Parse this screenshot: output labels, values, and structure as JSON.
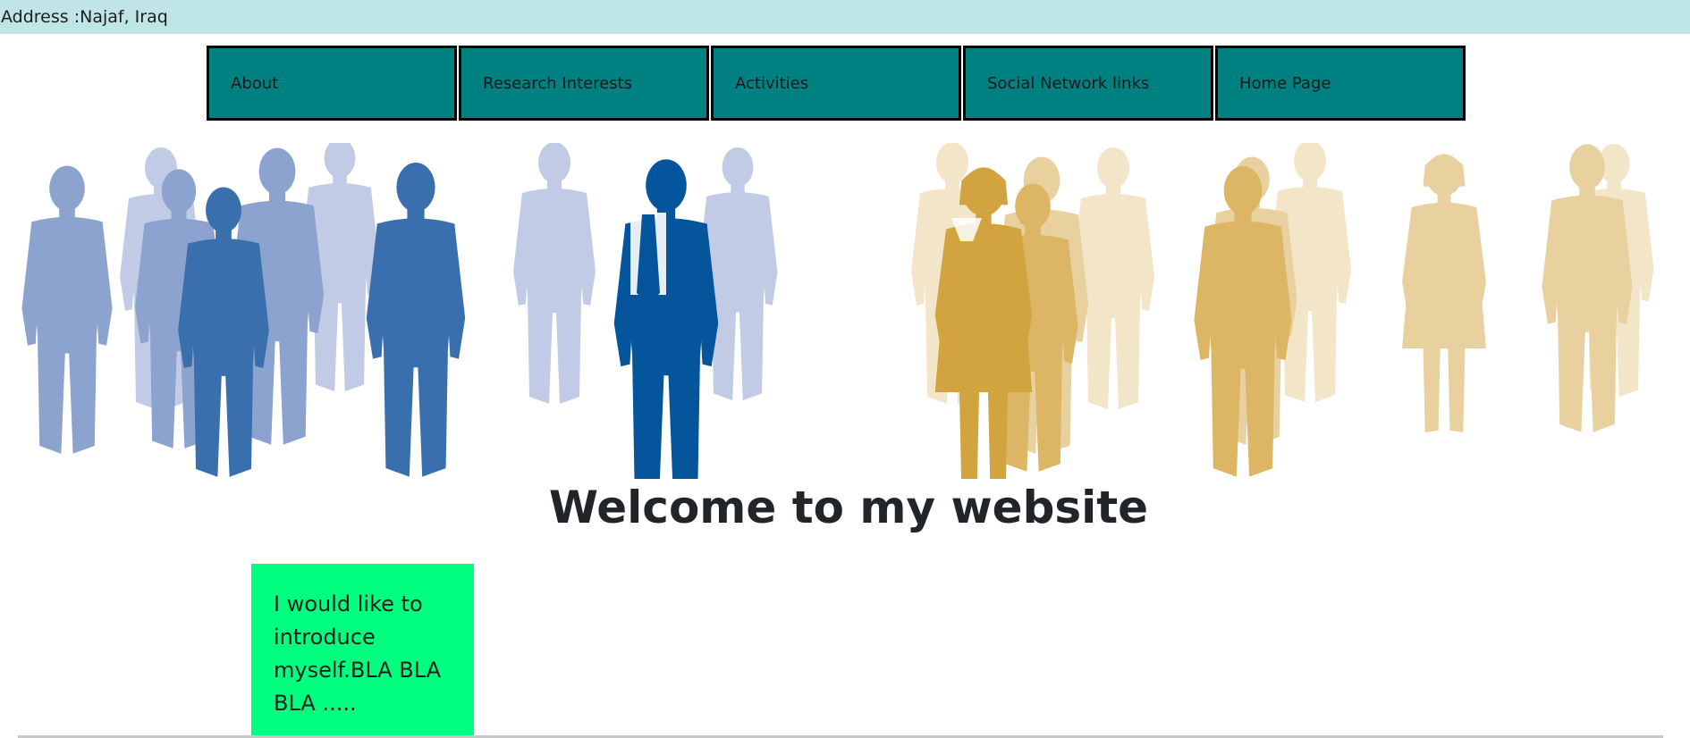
{
  "header": {
    "address": "Address :Najaf, Iraq"
  },
  "nav": {
    "items": [
      {
        "label": "About"
      },
      {
        "label": "Research Interests"
      },
      {
        "label": "Activities"
      },
      {
        "label": "Social Network links"
      },
      {
        "label": "Home Page"
      }
    ]
  },
  "hero": {
    "description": "",
    "colors": {
      "blue_dark": "#04559b",
      "blue_mid": "#3a6fae",
      "blue_light": "#8ca2cf",
      "blue_pale": "#c2cbe5",
      "gold_dark": "#d2a440",
      "gold_mid": "#ddb665",
      "gold_light": "#e8d19e",
      "gold_pale": "#f2e5c8"
    }
  },
  "main": {
    "title": "Welcome to my website",
    "intro_text": "I would like to introduce myself.BLA BLA BLA ....."
  },
  "theme": {
    "top_bar_bg": "#bfe5e6",
    "nav_bg": "#008080",
    "intro_bg": "#00ff7f"
  }
}
